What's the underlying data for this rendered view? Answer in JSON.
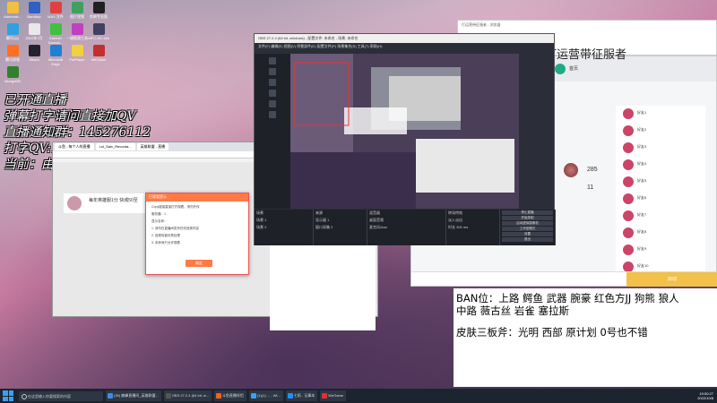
{
  "desktop_icons": [
    {
      "label": "Administr...",
      "color": "#f0c040"
    },
    {
      "label": "Bandizip",
      "color": "#3060c0"
    },
    {
      "label": "MAX 文件",
      "color": "#e04040"
    },
    {
      "label": "图片视频",
      "color": "#40a060"
    },
    {
      "label": "剪映专业版",
      "color": "#202020"
    },
    {
      "label": "腾讯QQ",
      "color": "#2fa0e0"
    },
    {
      "label": "2022年7月",
      "color": "#e8e8e8"
    },
    {
      "label": "Internet Downlo...",
      "color": "#40c040"
    },
    {
      "label": "一键换源工具",
      "color": "#c040c0"
    },
    {
      "label": "MPC-HC x64",
      "color": "#404060"
    },
    {
      "label": "腾讯视频",
      "color": "#ff7020"
    },
    {
      "label": "Steam",
      "color": "#223"
    },
    {
      "label": "Microsoft Edge",
      "color": "#2080d0"
    },
    {
      "label": "PotPlayer",
      "color": "#f0d040"
    },
    {
      "label": "WeGame",
      "color": "#c03030"
    },
    {
      "label": "MongoDB",
      "color": "#308030"
    }
  ],
  "overlay_lines": [
    "已开通直播",
    "弹幕打字请问直接加QV",
    "直播通知群：145276112",
    "打字QV:1030891615",
    "当前：由一局会"
  ],
  "browser": {
    "tabs": [
      "斗鱼 - 每个人的直播",
      "Lol_Saix_Recorda...",
      "英雄联盟 - 直播"
    ],
    "streamer_name": "每年英雄服1分 快城50至"
  },
  "dialog": {
    "header": "已观看提示",
    "rows": [
      "Copy链接直接打开观看，请勿外传",
      "服务器：1",
      "显示名称：",
      "1. 请勿在直播间发布任何违规内容",
      "2. 违规将被封禁处理",
      "3. 本房间只允许观看"
    ],
    "button": "确定"
  },
  "obs": {
    "title": "OBS 27.2.4 (64 bit, windows) - 配置文件: 未命名 - 场景: 未命名",
    "menu": "文件(F)  编辑(E)  视图(V)  停靠部件(D)  配置文件(P)  场景集合(S)  工具(T)  帮助(H)",
    "docks": [
      {
        "title": "场景",
        "items": [
          "场景 1",
          "场景 2"
        ]
      },
      {
        "title": "来源",
        "items": [
          "显示器 1",
          "窗口采集 2"
        ]
      },
      {
        "title": "混音器",
        "items": [
          "桌面音频",
          "麦克风/Aux"
        ]
      },
      {
        "title": "转场特效",
        "items": [
          "淡入淡出",
          "时长 300 ms"
        ]
      },
      {
        "title": "控件",
        "items": [
          "停止直播",
          "开始录制",
          "启动虚拟摄像机",
          "工作室模式",
          "设置",
          "退出"
        ]
      }
    ]
  },
  "client": {
    "title": "打运营带征服者",
    "nav_label": "首页",
    "rank_numbers": [
      "285",
      "11"
    ],
    "friends": [
      "好友1",
      "好友2",
      "好友3",
      "好友4",
      "好友5",
      "好友6",
      "好友7",
      "好友8",
      "好友9",
      "好友10"
    ],
    "start_label": "启动"
  },
  "ban_panel": {
    "line1": "BAN位：上路 鳄鱼 武器 腕豪 红色方JJ 狗熊 狼人",
    "line2": "中路 薇古丝 岩雀 塞拉斯",
    "line3": "皮肤三板斧：光明 西部 原计划  0号也不错"
  },
  "mini_window": {
    "title": "打运营带征服者 - 浏览器"
  },
  "taskbar": {
    "search_placeholder": "在这里输入你要搜索的内容",
    "apps": [
      {
        "label": "(39) 巅峰直播间_英雄联盟...",
        "color": "#3c8de0"
      },
      {
        "label": "OBS 27.2.4 (64 bit, w...",
        "color": "#555"
      },
      {
        "label": "斗鱼直播伴侣",
        "color": "#f06020"
      },
      {
        "label": "(1)(1) ... - Wi...",
        "color": "#3aa0f0"
      },
      {
        "label": "七雨 - 记事本",
        "color": "#1e90ff"
      },
      {
        "label": "WeGame",
        "color": "#e03030"
      }
    ],
    "time": "19:50:27",
    "date": "2022/10/8"
  }
}
